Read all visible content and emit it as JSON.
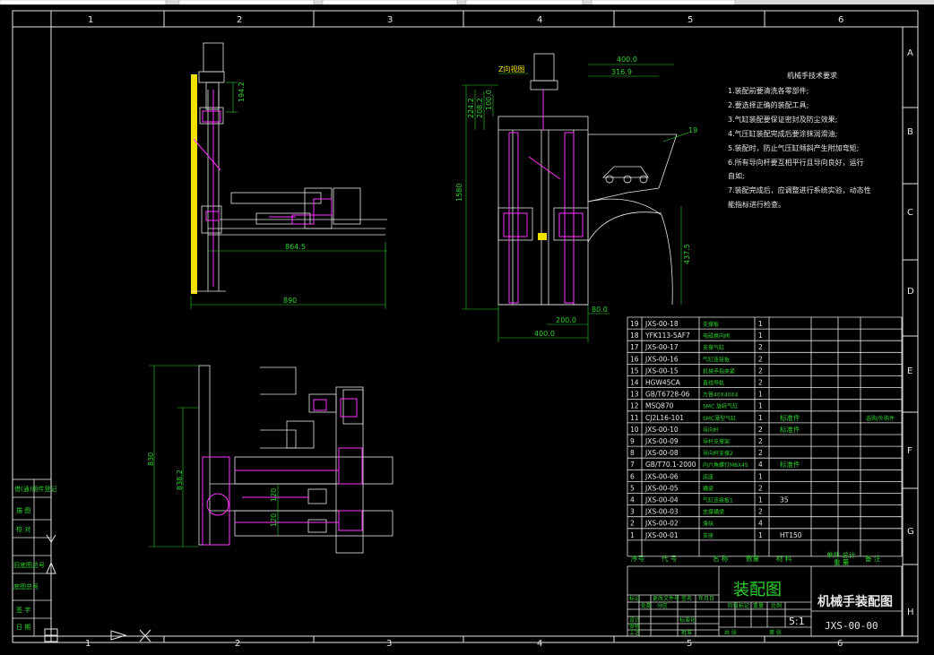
{
  "toolbar": {
    "visible": true
  },
  "drawing": {
    "title": "机械手装配图",
    "drawing_no": "JXS-00-00",
    "view_name": "装配图",
    "scale": "5:1",
    "material_cell": "",
    "border_cols": [
      "1",
      "2",
      "3",
      "4",
      "5",
      "6"
    ],
    "border_rows": [
      "A",
      "B",
      "C",
      "D",
      "E",
      "F",
      "G",
      "H"
    ],
    "dims": {
      "d194": "194.2",
      "d864": "864.5",
      "d890": "890",
      "d400a": "400.0",
      "d316": "316.9",
      "d224": "224.2",
      "d208": "208.2",
      "d100": "100.0",
      "d1580": "1580",
      "d437": "437.5",
      "d19": "19",
      "d80": "80.0",
      "d200": "200.0",
      "d400b": "400.0",
      "d830": "830",
      "d838": "838.2",
      "d120a": "120",
      "d120b": "120",
      "zlabel": "Z向视图"
    },
    "notes": {
      "heading": "机械手技术要求",
      "lines": [
        "1.装配前要清洗各零部件;",
        "2.要选择正确的装配工具;",
        "3.气缸装配要保证密封及防尘效果;",
        "4.气压缸装配完成后要涂抹润滑油;",
        "5.装配时，防止气压缸倾斜产生附加弯矩;",
        "6.所有导向杆要互相平行且导向良好，运行",
        "   自如;",
        "7.装配完成后，应调整进行系统实验，动态性",
        "   能指标进行检查。"
      ]
    },
    "left_stamp": [
      "借(通)用件登记",
      "描 图",
      "校 对",
      "旧底图总号",
      "底图总号",
      "签 字",
      "日 期"
    ],
    "bom_rows": [
      {
        "no": "19",
        "code": "JXS-00-18",
        "name": "支撑板",
        "qty": "1",
        "mat": "",
        "note": ""
      },
      {
        "no": "18",
        "code": "YFK113-5AF7",
        "name": "电磁换向阀",
        "qty": "1",
        "mat": "",
        "note": ""
      },
      {
        "no": "17",
        "code": "JXS-00-17",
        "name": "支撑气缸",
        "qty": "2",
        "mat": "",
        "note": ""
      },
      {
        "no": "16",
        "code": "JXS-00-16",
        "name": "气缸连接板",
        "qty": "2",
        "mat": "",
        "note": ""
      },
      {
        "no": "15",
        "code": "JXS-00-15",
        "name": "机械手指夹紧",
        "qty": "2",
        "mat": "",
        "note": ""
      },
      {
        "no": "14",
        "code": "HGW45CA",
        "name": "直线导轨",
        "qty": "2",
        "mat": "",
        "note": ""
      },
      {
        "no": "13",
        "code": "GB/T6728-06",
        "name": "方管40X40X4",
        "qty": "1",
        "mat": "",
        "note": ""
      },
      {
        "no": "12",
        "code": "MSQ870",
        "name": "SMC 旋转气缸",
        "qty": "1",
        "mat": "",
        "note": ""
      },
      {
        "no": "11",
        "code": "CJ2L16-101",
        "name": "SMC薄型气缸",
        "qty": "1",
        "mat": "标准件",
        "note": "选购/外购件"
      },
      {
        "no": "10",
        "code": "JXS-00-10",
        "name": "导向杆",
        "qty": "2",
        "mat": "标准件",
        "note": ""
      },
      {
        "no": "9",
        "code": "JXS-00-09",
        "name": "导杆支撑架",
        "qty": "2",
        "mat": "",
        "note": ""
      },
      {
        "no": "8",
        "code": "JXS-00-08",
        "name": "导向杆支撑2",
        "qty": "2",
        "mat": "",
        "note": ""
      },
      {
        "no": "7",
        "code": "GB/T70.1-2000",
        "name": "内六角螺钉M8X45",
        "qty": "4",
        "mat": "标准件",
        "note": ""
      },
      {
        "no": "6",
        "code": "JXS-00-06",
        "name": "底座",
        "qty": "1",
        "mat": "",
        "note": ""
      },
      {
        "no": "5",
        "code": "JXS-00-05",
        "name": "横梁",
        "qty": "2",
        "mat": "",
        "note": ""
      },
      {
        "no": "4",
        "code": "JXS-00-04",
        "name": "气缸连接板1",
        "qty": "1",
        "mat": "35",
        "note": ""
      },
      {
        "no": "3",
        "code": "JXS-00-03",
        "name": "支撑横梁",
        "qty": "2",
        "mat": "",
        "note": ""
      },
      {
        "no": "2",
        "code": "JXS-00-02",
        "name": "滑块",
        "qty": "4",
        "mat": "",
        "note": ""
      },
      {
        "no": "1",
        "code": "JXS-00-01",
        "name": "支座",
        "qty": "1",
        "mat": "HT150",
        "note": ""
      }
    ],
    "bom_header": {
      "no": "序号",
      "code": "代 号",
      "name": "名 称",
      "qty": "数量",
      "mat": "材 料",
      "weight": "单件 总计",
      "weight2": "重 量",
      "note": "备 注"
    },
    "title_block_small": [
      "标记",
      "处数",
      "分区",
      "更改文件号",
      "签名",
      "年月日",
      "设计",
      "标准化",
      "审核",
      "工艺",
      "批准",
      "阶段标记",
      "重量",
      "比例",
      "共 张",
      "第 张"
    ]
  },
  "colors": {
    "frame": "#e6e6e6",
    "dim": "#2cd22c",
    "part": "#e6e6e6",
    "accent": "#ff33ff",
    "yellow": "#f0e000"
  }
}
